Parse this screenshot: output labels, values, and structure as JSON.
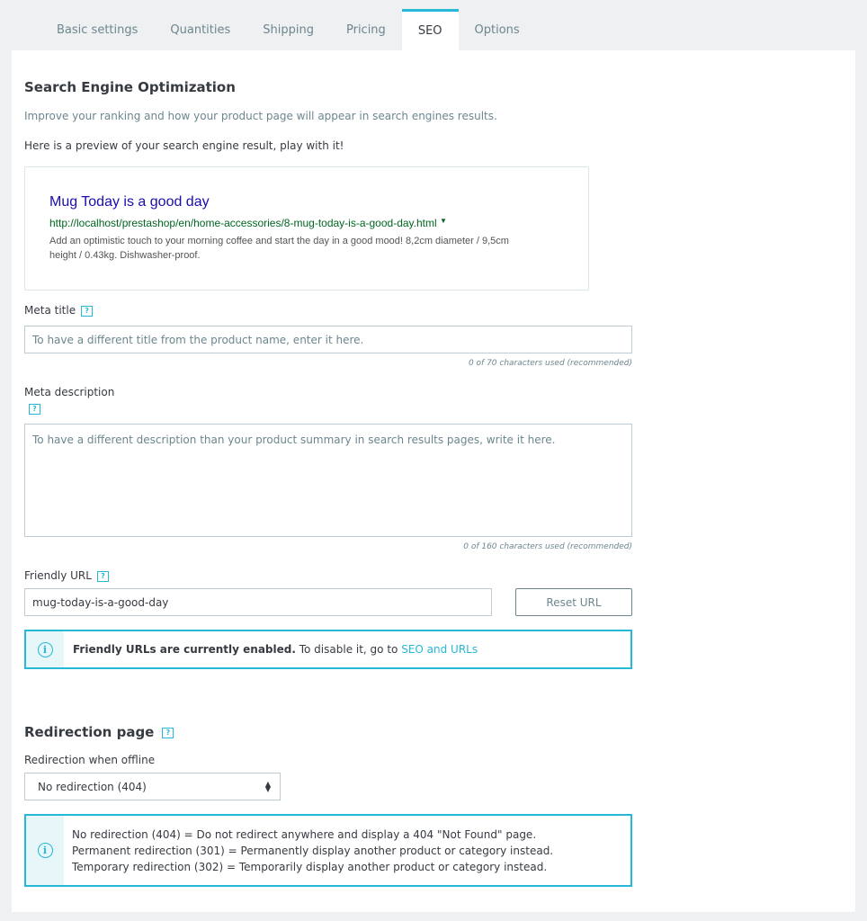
{
  "tabs": [
    {
      "label": "Basic settings"
    },
    {
      "label": "Quantities"
    },
    {
      "label": "Shipping"
    },
    {
      "label": "Pricing"
    },
    {
      "label": "SEO",
      "active": true
    },
    {
      "label": "Options"
    }
  ],
  "seo": {
    "heading": "Search Engine Optimization",
    "subtitle": "Improve your ranking and how your product page will appear in search engines results.",
    "preview_intro": "Here is a preview of your search engine result, play with it!",
    "preview": {
      "title": "Mug Today is a good day",
      "url": "http://localhost/prestashop/en/home-accessories/8-mug-today-is-a-good-day.html",
      "description_line1": "Add an optimistic touch to your morning coffee and start the day in a good mood! 8,2cm diameter / 9,5cm",
      "description_line2": "height / 0.43kg. Dishwasher-proof."
    },
    "meta_title": {
      "label": "Meta title",
      "placeholder": "To have a different title from the product name, enter it here.",
      "counter": "0 of 70 characters used (recommended)"
    },
    "meta_description": {
      "label": "Meta description",
      "placeholder": "To have a different description than your product summary in search results pages, write it here.",
      "counter": "0 of 160 characters used (recommended)"
    },
    "friendly_url": {
      "label": "Friendly URL",
      "value": "mug-today-is-a-good-day",
      "reset_button": "Reset URL"
    },
    "friendly_alert": {
      "bold": "Friendly URLs are currently enabled.",
      "text": " To disable it, go to ",
      "link": "SEO and URLs"
    }
  },
  "redirection": {
    "heading": "Redirection page",
    "label": "Redirection when offline",
    "selected": "No redirection (404)",
    "info_lines": [
      "No redirection (404) = Do not redirect anywhere and display a 404 \"Not Found\" page.",
      "Permanent redirection (301) = Permanently display another product or category instead.",
      "Temporary redirection (302) = Temporarily display another product or category instead."
    ]
  },
  "icons": {
    "help": "help-icon",
    "info": "info-icon",
    "select_arrows": "select-arrows-icon",
    "dropdown": "caret-down-icon"
  },
  "colors": {
    "accent": "#25b9d7",
    "serp_title": "#1a0dab",
    "serp_url": "#006621"
  }
}
